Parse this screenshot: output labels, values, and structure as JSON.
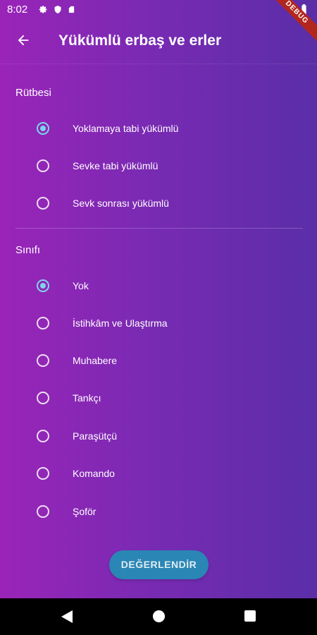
{
  "status_bar": {
    "time": "8:02",
    "icons": [
      "settings-icon",
      "shield-icon",
      "sd-card-icon",
      "wifi-icon",
      "battery-icon"
    ],
    "debug_label": "DEBUG"
  },
  "app_bar": {
    "title": "Yükümlü erbaş ve erler",
    "back_icon": "arrow-back-icon"
  },
  "rank_section": {
    "title": "Rütbesi",
    "options": [
      {
        "label": "Yoklamaya tabi yükümlü",
        "selected": true
      },
      {
        "label": "Sevke tabi yükümlü",
        "selected": false
      },
      {
        "label": "Sevk sonrası yükümlü",
        "selected": false
      }
    ]
  },
  "class_section": {
    "title": "Sınıfı",
    "options": [
      {
        "label": "Yok",
        "selected": true
      },
      {
        "label": "İstihkâm ve Ulaştırma",
        "selected": false
      },
      {
        "label": "Muhabere",
        "selected": false
      },
      {
        "label": "Tankçı",
        "selected": false
      },
      {
        "label": "Paraşütçü",
        "selected": false
      },
      {
        "label": "Komando",
        "selected": false
      },
      {
        "label": "Şoför",
        "selected": false
      }
    ]
  },
  "evaluate_button": {
    "label": "DEĞERLENDİR"
  },
  "colors": {
    "gradient_start": "#9a24b8",
    "gradient_end": "#5a2ea8",
    "radio_selected": "#7fd4ee",
    "button": "#2a86b5",
    "debug_banner": "#b3261e"
  },
  "nav_bar": {
    "icons": [
      "nav-back-icon",
      "nav-home-icon",
      "nav-recents-icon"
    ]
  }
}
